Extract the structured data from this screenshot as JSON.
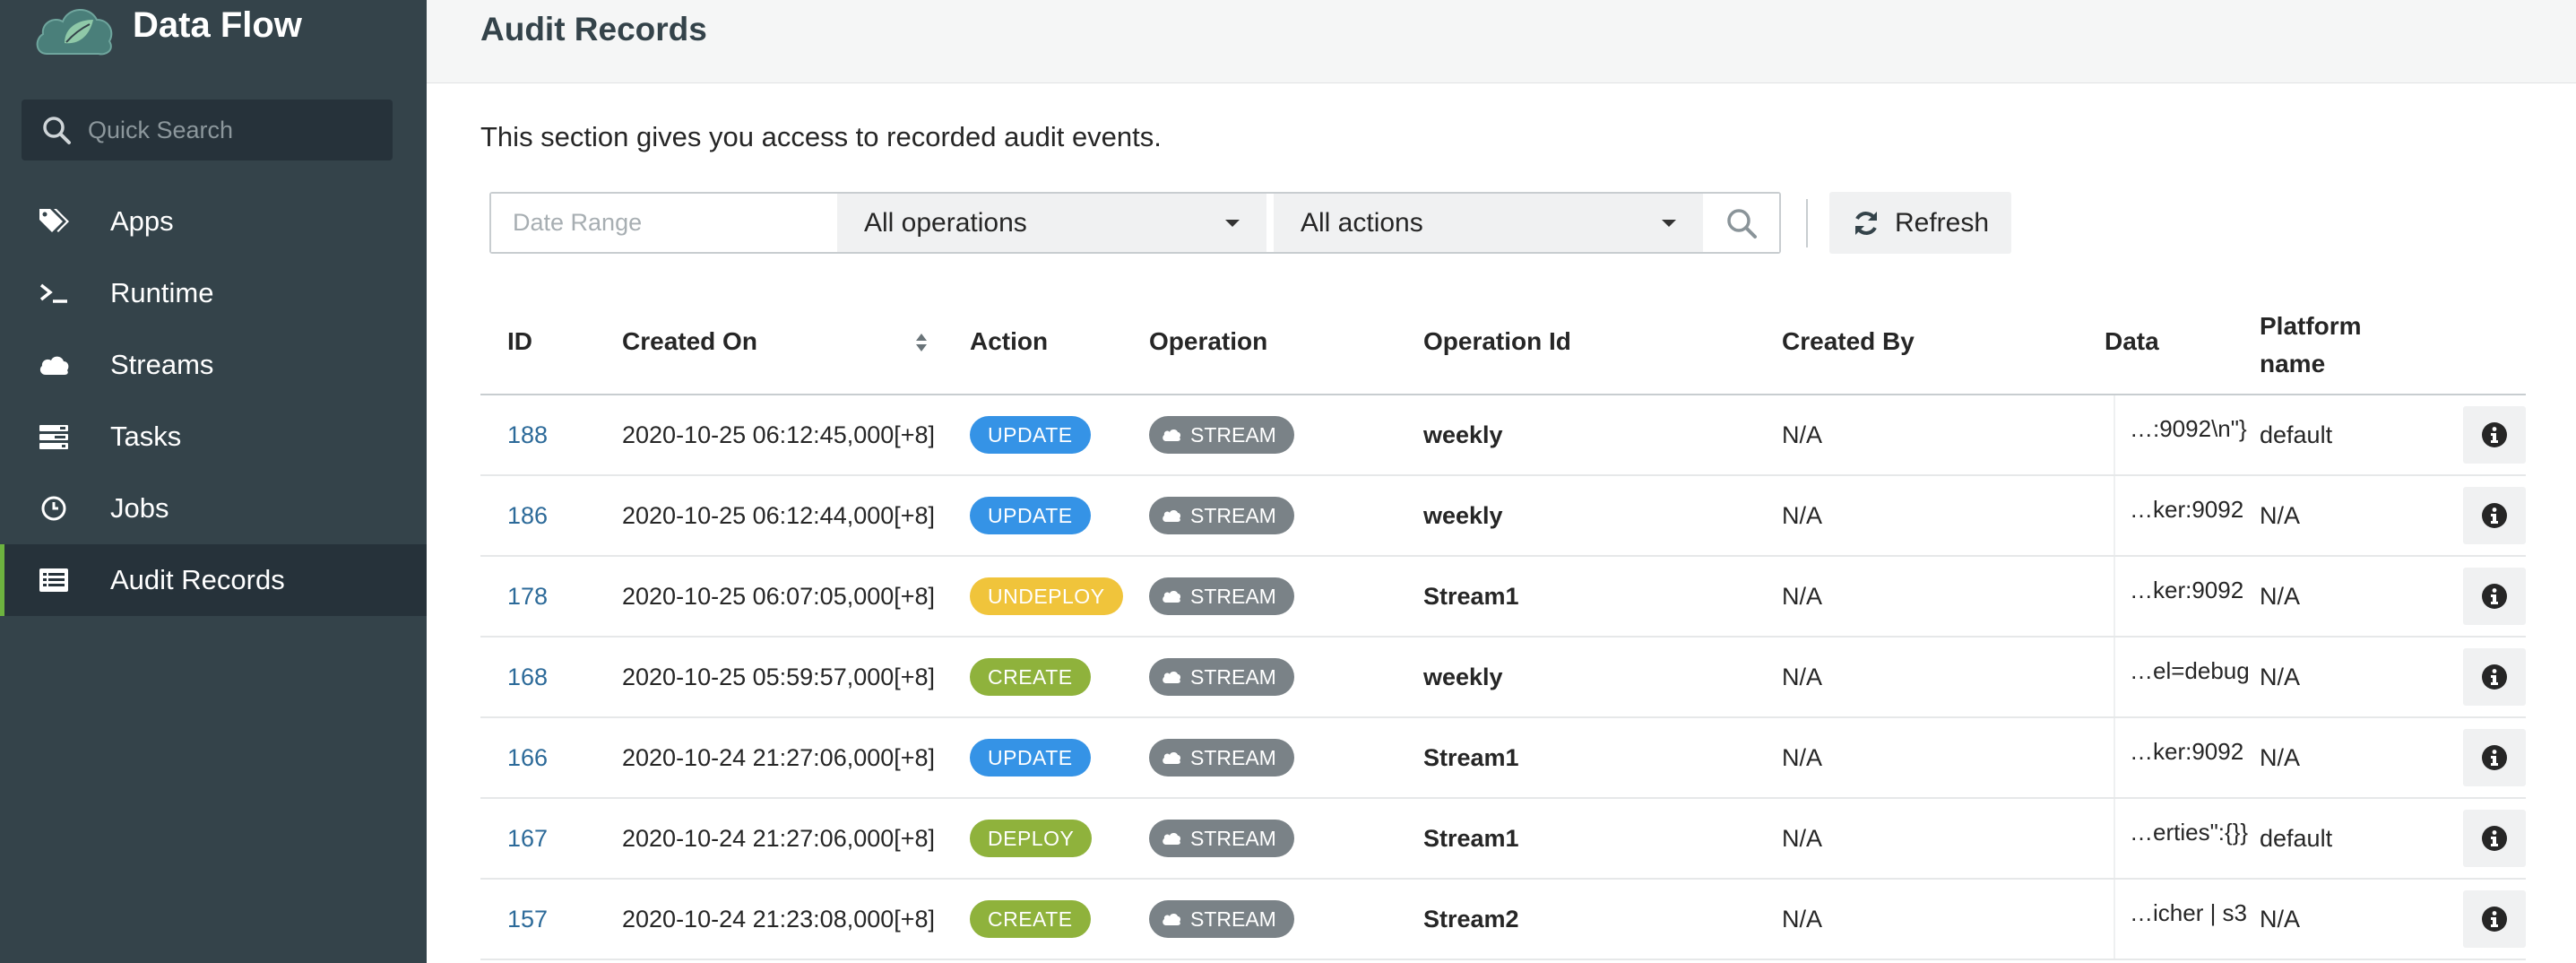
{
  "app": {
    "title": "Data Flow"
  },
  "sidebar": {
    "search_placeholder": "Quick Search",
    "items": [
      {
        "label": "Apps",
        "icon": "tags-icon"
      },
      {
        "label": "Runtime",
        "icon": "terminal-icon"
      },
      {
        "label": "Streams",
        "icon": "cloud-icon"
      },
      {
        "label": "Tasks",
        "icon": "tasks-list-icon"
      },
      {
        "label": "Jobs",
        "icon": "clock-icon"
      },
      {
        "label": "Audit Records",
        "icon": "list-alt-icon",
        "active": true
      }
    ]
  },
  "page": {
    "title": "Audit Records",
    "description": "This section gives you access to recorded audit events."
  },
  "filters": {
    "date_placeholder": "Date Range",
    "operations_selected": "All operations",
    "actions_selected": "All actions",
    "refresh_label": "Refresh"
  },
  "table": {
    "columns": {
      "id": "ID",
      "created_on": "Created On",
      "action": "Action",
      "operation": "Operation",
      "operation_id": "Operation Id",
      "created_by": "Created By",
      "data": "Data",
      "platform_line1": "Platform",
      "platform_line2": "name"
    },
    "rows": [
      {
        "id": "188",
        "created_on": "2020-10-25 06:12:45,000[+8]",
        "action": "UPDATE",
        "action_type": "update",
        "operation": "STREAM",
        "operation_id": "weekly",
        "created_by": "N/A",
        "data": "…:9092\\n\"}",
        "platform": "default"
      },
      {
        "id": "186",
        "created_on": "2020-10-25 06:12:44,000[+8]",
        "action": "UPDATE",
        "action_type": "update",
        "operation": "STREAM",
        "operation_id": "weekly",
        "created_by": "N/A",
        "data": "…ker:9092",
        "platform": "N/A"
      },
      {
        "id": "178",
        "created_on": "2020-10-25 06:07:05,000[+8]",
        "action": "UNDEPLOY",
        "action_type": "undeploy",
        "operation": "STREAM",
        "operation_id": "Stream1",
        "created_by": "N/A",
        "data": "…ker:9092",
        "platform": "N/A"
      },
      {
        "id": "168",
        "created_on": "2020-10-25 05:59:57,000[+8]",
        "action": "CREATE",
        "action_type": "create",
        "operation": "STREAM",
        "operation_id": "weekly",
        "created_by": "N/A",
        "data": "…el=debug",
        "platform": "N/A"
      },
      {
        "id": "166",
        "created_on": "2020-10-24 21:27:06,000[+8]",
        "action": "UPDATE",
        "action_type": "update",
        "operation": "STREAM",
        "operation_id": "Stream1",
        "created_by": "N/A",
        "data": "…ker:9092",
        "platform": "N/A"
      },
      {
        "id": "167",
        "created_on": "2020-10-24 21:27:06,000[+8]",
        "action": "DEPLOY",
        "action_type": "deploy",
        "operation": "STREAM",
        "operation_id": "Stream1",
        "created_by": "N/A",
        "data": "…erties\":{}}",
        "platform": "default"
      },
      {
        "id": "157",
        "created_on": "2020-10-24 21:23:08,000[+8]",
        "action": "CREATE",
        "action_type": "create",
        "operation": "STREAM",
        "operation_id": "Stream2",
        "created_by": "N/A",
        "data": "…icher | s3",
        "platform": "N/A"
      }
    ]
  },
  "colors": {
    "sidebar_bg": "#34434a",
    "sidebar_active_bg": "#26323a",
    "accent_green": "#6db33f",
    "link_blue": "#2c6a99",
    "badge_update": "#3593e6",
    "badge_undeploy": "#f0c43b",
    "badge_create": "#8fb23c",
    "badge_stream": "#7a8287"
  }
}
